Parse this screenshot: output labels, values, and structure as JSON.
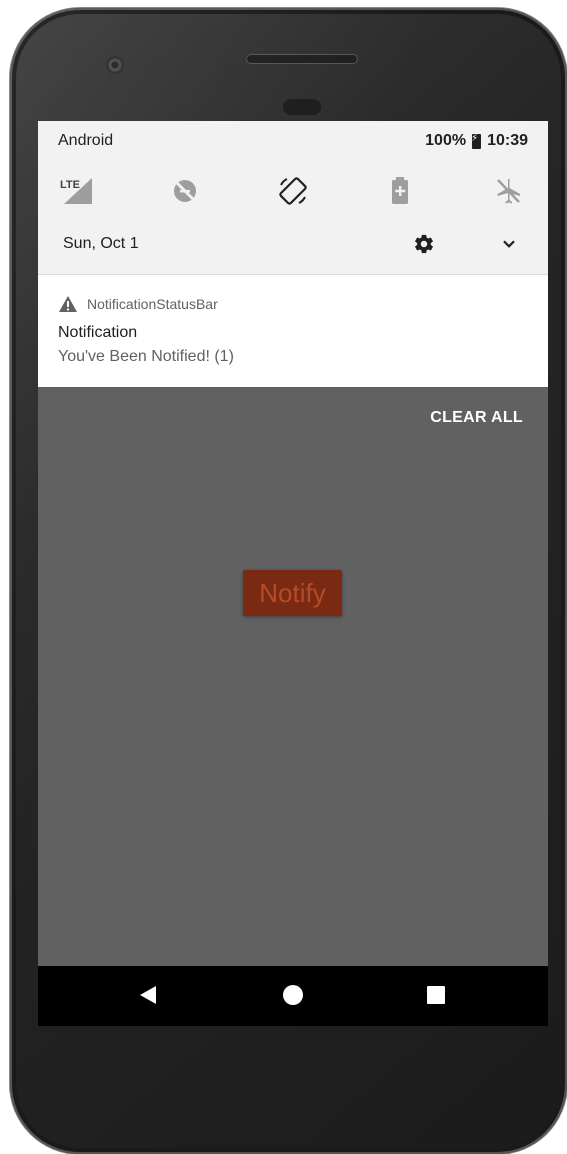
{
  "status_bar": {
    "carrier": "Android",
    "battery": "100%",
    "time": "10:39"
  },
  "quick_settings": {
    "tiles": [
      {
        "name": "lte-signal-icon",
        "label": "LTE"
      },
      {
        "name": "data-saver-icon"
      },
      {
        "name": "auto-rotate-icon"
      },
      {
        "name": "battery-saver-icon"
      },
      {
        "name": "airplane-mode-icon"
      }
    ],
    "date": "Sun, Oct 1"
  },
  "notification": {
    "app_name": "NotificationStatusBar",
    "title": "Notification",
    "text": "You've Been Notified! (1)"
  },
  "clear_all_label": "CLEAR ALL",
  "app": {
    "notify_button_label": "Notify"
  },
  "colors": {
    "screen_bg": "#616161",
    "notify_button_bg": "#7a2a12",
    "notify_button_text": "#b84a2a"
  }
}
